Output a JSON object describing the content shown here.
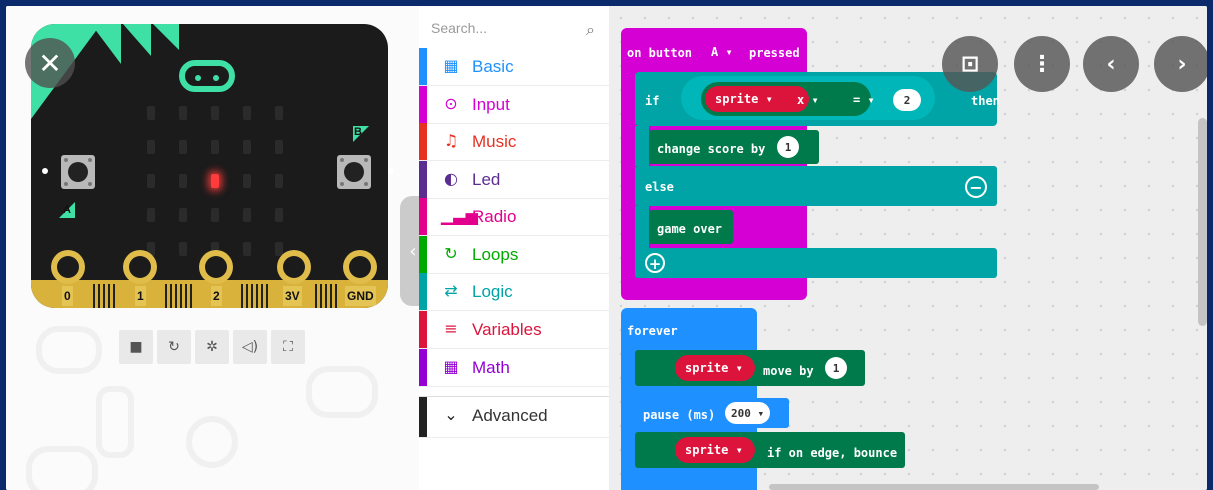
{
  "simulator": {
    "close_icon": "close-icon",
    "buttons": {
      "a": "A",
      "b": "B"
    },
    "pins": [
      "0",
      "1",
      "2",
      "3V",
      "GND"
    ],
    "led_lit": {
      "row": 2,
      "col": 2
    },
    "controls": [
      {
        "name": "stop-icon",
        "glyph": "■"
      },
      {
        "name": "restart-icon",
        "glyph": "↻"
      },
      {
        "name": "debug-icon",
        "glyph": "✲"
      },
      {
        "name": "mute-icon",
        "glyph": "◁)"
      },
      {
        "name": "fullscreen-icon",
        "glyph": "⛶"
      }
    ]
  },
  "toolbox": {
    "search_placeholder": "Search...",
    "categories": [
      {
        "label": "Basic",
        "color": "#1e90ff",
        "icon": "▦"
      },
      {
        "label": "Input",
        "color": "#d400d4",
        "icon": "⊙"
      },
      {
        "label": "Music",
        "color": "#e63022",
        "icon": "♫"
      },
      {
        "label": "Led",
        "color": "#5c2d91",
        "icon": "◐"
      },
      {
        "label": "Radio",
        "color": "#e3008c",
        "icon": "▁▃▅"
      },
      {
        "label": "Loops",
        "color": "#00aa00",
        "icon": "↻"
      },
      {
        "label": "Logic",
        "color": "#00a4a6",
        "icon": "⇄"
      },
      {
        "label": "Variables",
        "color": "#dc143c",
        "icon": "≡"
      },
      {
        "label": "Math",
        "color": "#9400d3",
        "icon": "▦"
      },
      {
        "label": "Advanced",
        "color": "#222222",
        "icon": "⌄"
      }
    ]
  },
  "workspace": {
    "event_block": {
      "label": "on button",
      "button": "A ▾",
      "action": "pressed"
    },
    "if_block": {
      "if": "if",
      "variable": "sprite ▾",
      "prop": "x ▾",
      "op": "= ▾",
      "value": "2",
      "then": "then",
      "else": "else"
    },
    "change_block": {
      "label": "change score by",
      "value": "1"
    },
    "game_over": "game over",
    "forever_block": {
      "label": "forever",
      "move_sprite": "sprite ▾",
      "move_label": "move by",
      "move_value": "1",
      "pause_label": "pause (ms)",
      "pause_value": "200 ▾",
      "bounce_sprite": "sprite ▾",
      "bounce_label": "if on edge, bounce"
    },
    "overlay_buttons": [
      "screenshot-icon",
      "more-icon",
      "back-icon",
      "forward-icon"
    ]
  },
  "colors": {
    "frame": "#0b2a6b",
    "input_block": "#d400d4",
    "logic_block": "#00a4a6",
    "game_block": "#007a4b",
    "loops_block": "#1e90ff",
    "variables_block": "#dc143c"
  }
}
